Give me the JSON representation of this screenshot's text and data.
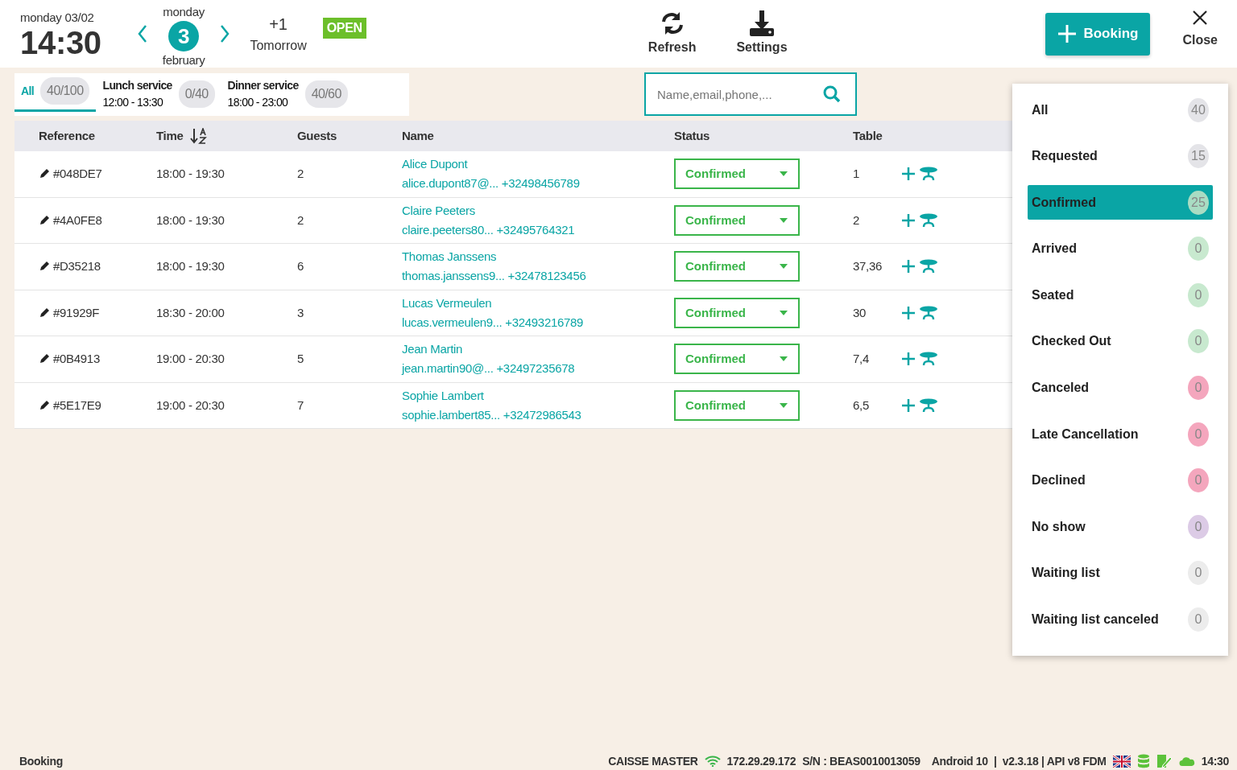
{
  "header": {
    "date_label": "monday 03/02",
    "time": "14:30",
    "day_picker": {
      "weekday": "monday",
      "day": "3",
      "month": "february"
    },
    "tomorrow": {
      "offset": "+1",
      "label": "Tomorrow"
    },
    "open_badge": "OPEN"
  },
  "toolbar": [
    {
      "kind": "refresh",
      "label": "Refresh"
    },
    {
      "kind": "download",
      "label": "Settings"
    }
  ],
  "new_booking_button": "Booking",
  "close_button": "Close",
  "services": [
    {
      "label": "All",
      "count": "40/100",
      "selected": true
    },
    {
      "label": "Lunch service",
      "hours": "12:00 - 13:30",
      "count": "0/40",
      "selected": false
    },
    {
      "label": "Dinner service",
      "hours": "18:00 - 23:00",
      "count": "40/60",
      "selected": false
    }
  ],
  "search": {
    "placeholder": "Name,email,phone,..."
  },
  "table": {
    "columns": [
      {
        "label": "Reference",
        "sorted": false
      },
      {
        "label": "Time",
        "sorted": true
      },
      {
        "label": "Guests",
        "sorted": false
      },
      {
        "label": "Name",
        "sorted": false
      },
      {
        "label": "Status",
        "sorted": false
      },
      {
        "label": "Table",
        "sorted": false
      }
    ],
    "rows": [
      {
        "reference": "#048DE7",
        "time": "18:00 - 19:30",
        "guests": "2",
        "name": "Alice Dupont",
        "email": "alice.dupont87@...",
        "phone": "+32498456789",
        "status": "Confirmed",
        "table": "1"
      },
      {
        "reference": "#4A0FE8",
        "time": "18:00 - 19:30",
        "guests": "2",
        "name": "Claire Peeters",
        "email": "claire.peeters80...",
        "phone": "+32495764321",
        "status": "Confirmed",
        "table": "2"
      },
      {
        "reference": "#D35218",
        "time": "18:00 - 19:30",
        "guests": "6",
        "name": "Thomas Janssens",
        "email": "thomas.janssens9...",
        "phone": "+32478123456",
        "status": "Confirmed",
        "table": "37,36"
      },
      {
        "reference": "#91929F",
        "time": "18:30 - 20:00",
        "guests": "3",
        "name": "Lucas Vermeulen",
        "email": "lucas.vermeulen9...",
        "phone": "+32493216789",
        "status": "Confirmed",
        "table": "30"
      },
      {
        "reference": "#0B4913",
        "time": "19:00 - 20:30",
        "guests": "5",
        "name": "Jean Martin",
        "email": "jean.martin90@...",
        "phone": "+32497235678",
        "status": "Confirmed",
        "table": "7,4"
      },
      {
        "reference": "#5E17E9",
        "time": "19:00 - 20:30",
        "guests": "7",
        "name": "Sophie Lambert",
        "email": "sophie.lambert85...",
        "phone": "+32472986543",
        "status": "Confirmed",
        "table": "6,5"
      }
    ]
  },
  "status_filter": [
    {
      "label": "All",
      "count": "40",
      "color": "#e4e4e8",
      "selected": false
    },
    {
      "label": "Requested",
      "count": "15",
      "color": "#e4e4e8",
      "selected": false
    },
    {
      "label": "Confirmed",
      "count": "25",
      "color": "#a9dcc3",
      "selected": true
    },
    {
      "label": "Arrived",
      "count": "0",
      "color": "#c8e9cf",
      "selected": false
    },
    {
      "label": "Seated",
      "count": "0",
      "color": "#c8e9cf",
      "selected": false
    },
    {
      "label": "Checked Out",
      "count": "0",
      "color": "#c8e9cf",
      "selected": false
    },
    {
      "label": "Canceled",
      "count": "0",
      "color": "#f4a6bd",
      "selected": false
    },
    {
      "label": "Late Cancellation",
      "count": "0",
      "color": "#f4a6bd",
      "selected": false
    },
    {
      "label": "Declined",
      "count": "0",
      "color": "#f4a6bd",
      "selected": false
    },
    {
      "label": "No show",
      "count": "0",
      "color": "#dccbe6",
      "selected": false
    },
    {
      "label": "Waiting list",
      "count": "0",
      "color": "#ececec",
      "selected": false
    },
    {
      "label": "Waiting list canceled",
      "count": "0",
      "color": "#ececec",
      "selected": false
    }
  ],
  "footer": {
    "page": "Booking",
    "device": "CAISSE MASTER",
    "ip": "172.29.29.172",
    "serial": "S/N : BEAS0010013059",
    "version": "Android 10  |  v2.3.18 | API v8 FDM",
    "clock": "14:30"
  }
}
